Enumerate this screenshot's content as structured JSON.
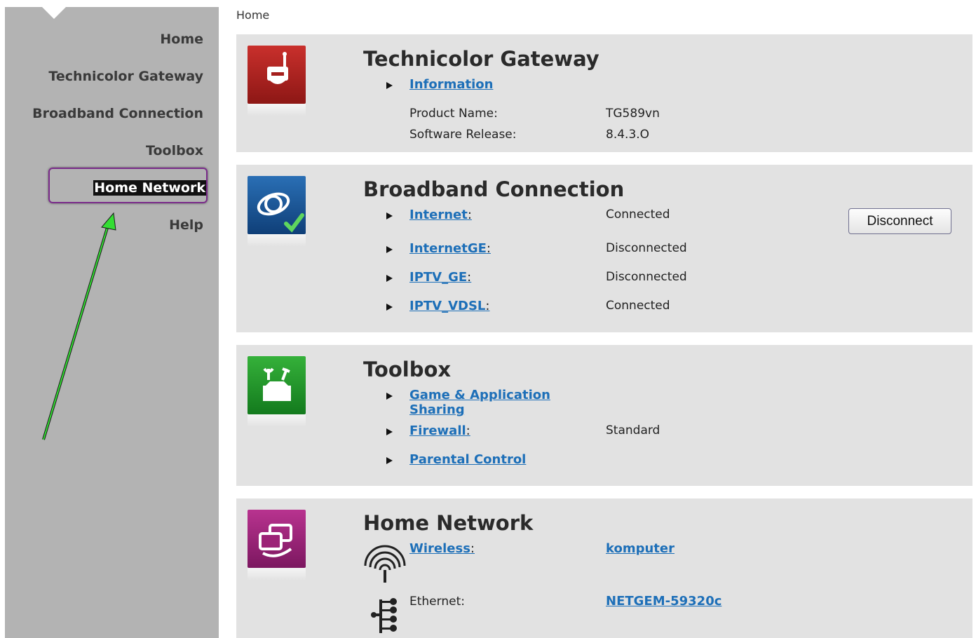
{
  "breadcrumb": "Home",
  "nav": {
    "items": [
      {
        "id": "home",
        "label": "Home"
      },
      {
        "id": "gateway",
        "label": "Technicolor Gateway"
      },
      {
        "id": "broadband",
        "label": "Broadband Connection"
      },
      {
        "id": "toolbox",
        "label": "Toolbox"
      },
      {
        "id": "home-network",
        "label": "Home Network",
        "active": true
      },
      {
        "id": "help",
        "label": "Help"
      }
    ]
  },
  "gateway": {
    "title": "Technicolor Gateway",
    "info_link": "Information",
    "product_name_label": "Product Name:",
    "product_name_value": "TG589vn",
    "software_release_label": "Software Release:",
    "software_release_value": "8.4.3.O"
  },
  "broadband": {
    "title": "Broadband Connection",
    "disconnect_label": "Disconnect",
    "connections": [
      {
        "name": "Internet",
        "status": "Connected"
      },
      {
        "name": "InternetGE",
        "status": "Disconnected"
      },
      {
        "name": "IPTV_GE",
        "status": "Disconnected"
      },
      {
        "name": "IPTV_VDSL",
        "status": "Connected"
      }
    ]
  },
  "toolbox": {
    "title": "Toolbox",
    "game_sharing_line1": "Game & Application",
    "game_sharing_line2": "Sharing",
    "firewall_link": "Firewall",
    "firewall_value": "Standard",
    "parental_link": "Parental Control"
  },
  "home_network": {
    "title": "Home Network",
    "wireless_link": "Wireless",
    "wireless_value": "komputer",
    "ethernet_label": "Ethernet:",
    "ethernet_value": "NETGEM-59320c"
  },
  "colors": {
    "sidebar": "#b3b3b3",
    "panel": "#e2e2e2",
    "link": "#1d6fb8",
    "highlight_border": "#7a2b8a",
    "arrow": "#22cc22"
  }
}
